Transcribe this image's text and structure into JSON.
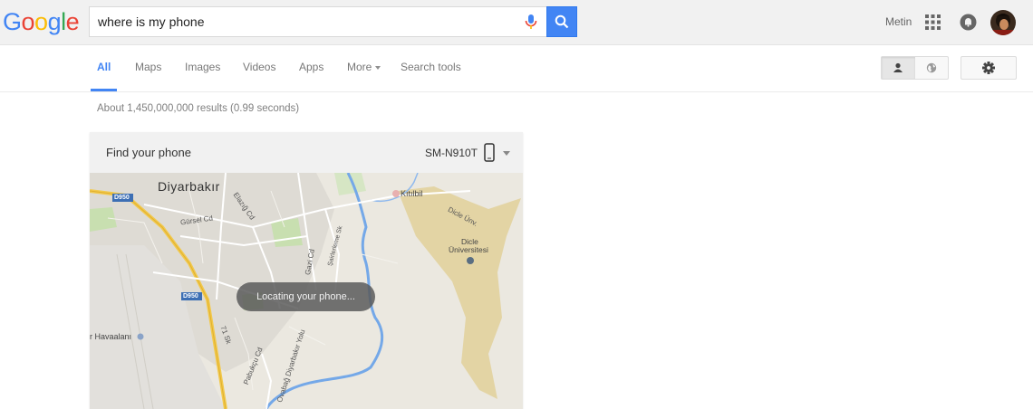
{
  "header": {
    "logo_letters": [
      {
        "char": "G",
        "color": "#4285f4"
      },
      {
        "char": "o",
        "color": "#ea4335"
      },
      {
        "char": "o",
        "color": "#fbbc05"
      },
      {
        "char": "g",
        "color": "#4285f4"
      },
      {
        "char": "l",
        "color": "#34a853"
      },
      {
        "char": "e",
        "color": "#ea4335"
      }
    ],
    "search_value": "where is my phone",
    "username": "Metin",
    "icons": {
      "mic": "microphone-icon",
      "search": "search-icon",
      "apps": "apps-grid-icon",
      "notifications": "notifications-icon",
      "avatar": "user-avatar"
    },
    "accent_color": "#4285f4"
  },
  "nav": {
    "tabs": [
      {
        "label": "All",
        "active": true
      },
      {
        "label": "Maps",
        "active": false
      },
      {
        "label": "Images",
        "active": false
      },
      {
        "label": "Videos",
        "active": false
      },
      {
        "label": "Apps",
        "active": false
      },
      {
        "label": "More",
        "active": false,
        "dropdown": true
      },
      {
        "label": "Search tools",
        "active": false
      }
    ],
    "results_toggle": [
      "person-icon",
      "globe-icon"
    ],
    "settings_icon": "gear-icon"
  },
  "stats": "About 1,450,000,000 results (0.99 seconds)",
  "card": {
    "title": "Find your phone",
    "device": "SM-N910T",
    "status": "Locating your phone...",
    "map_labels": {
      "city": "Diyarbakır",
      "road_d950_1": "D950",
      "road_d950_2": "D950",
      "elazig": "Elazığ Cd",
      "gursel": "Gürsel Cd",
      "gazi": "Gazi Cd",
      "kitilbil": "Kıtılbil",
      "dicle_univ": "Dicle Ünv.",
      "dicle_universitesi_1": "Dicle",
      "dicle_universitesi_2": "Üniversitesi",
      "havaalani": "r Havaalanı",
      "sk71": "71 Sk",
      "pabukcu": "Pabukçu Cd",
      "ovabag": "Ovabağ Diyarbakır Yolu",
      "sk_side": "Şairlerleme Sk"
    }
  }
}
